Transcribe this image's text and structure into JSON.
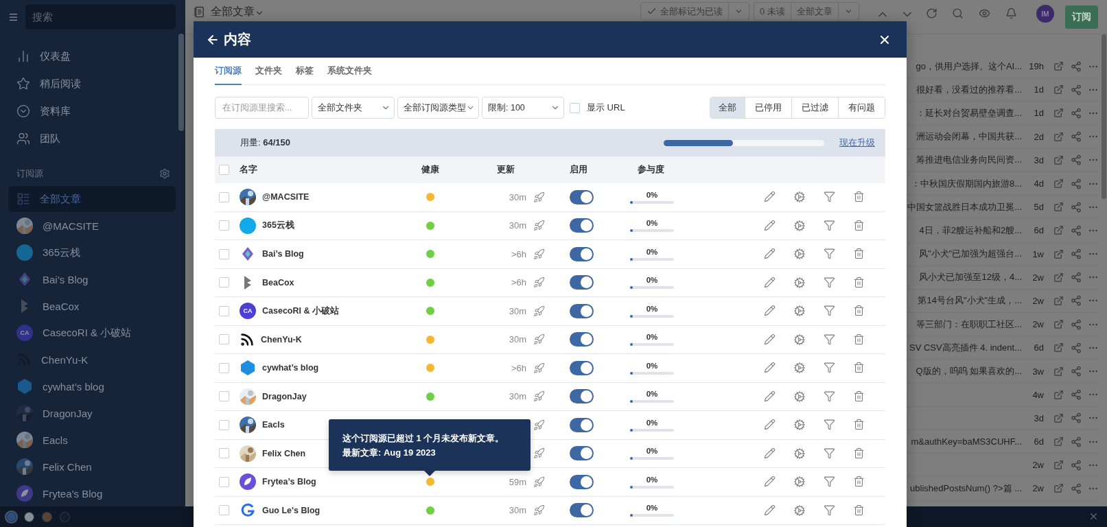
{
  "sidebar": {
    "search": {
      "placeholder": "搜索"
    },
    "nav": [
      "仪表盘",
      "稍后阅读",
      "资料库",
      "团队"
    ],
    "section_title": "订阅源",
    "feeds": [
      {
        "label": "全部文章",
        "kind": "list",
        "selected": true
      },
      {
        "label": "@MACSITE",
        "selected": false
      },
      {
        "label": "365云栈",
        "kind": "blob",
        "selected": false
      },
      {
        "label": "Bai’s Blog",
        "kind": "diamond",
        "selected": false
      },
      {
        "label": "BeaCox",
        "kind": "chevron",
        "selected": false
      },
      {
        "label": "CasecoRI & 小破站",
        "kind": "initials",
        "initials": "CA",
        "selected": false
      },
      {
        "label": "ChenYu-K",
        "kind": "rss",
        "selected": false
      },
      {
        "label": "cywhat’s blog",
        "kind": "hexagon",
        "selected": false
      },
      {
        "label": "DragonJay",
        "selected": false
      },
      {
        "label": "Eacls",
        "selected": false
      },
      {
        "label": "Felix Chen",
        "selected": false
      },
      {
        "label": "Frytea’s Blog",
        "kind": "leaf",
        "selected": false
      }
    ],
    "theme_dots": [
      {
        "color": "#2c4d80",
        "selected": true
      },
      {
        "color": "#8a8e95",
        "selected": false
      },
      {
        "color": "#5a4431",
        "selected": false
      },
      {
        "color": "#161b24",
        "selected": false
      }
    ]
  },
  "toolbar": {
    "title": "全部文章",
    "mark_read": "全部标记为已读",
    "unread": "0 未读",
    "filter": "全部文章",
    "avatar": "IM",
    "subscribe": "订阅"
  },
  "articles": [
    {
      "text": "go，供用户选择。这个AI...",
      "age": "19h"
    },
    {
      "text": "很好看，没看过的推荐看...",
      "age": "1d"
    },
    {
      "text": "：延长对台贸易壁垒调查...",
      "age": "1d"
    },
    {
      "text": "洲运动会闭幕，中国共获...",
      "age": "2d"
    },
    {
      "text": "筹推进电信业务向民间资...",
      "age": "3d"
    },
    {
      "text": "：中秋国庆假期国内旅游8...",
      "age": "4d"
    },
    {
      "text": "中国女篮战胜日本成功卫冕...",
      "age": "5d"
    },
    {
      "text": "4日，菲2艘运补船和2艘...",
      "age": "6d"
    },
    {
      "text": "风\"小犬\"已加强为超强台...",
      "age": "1w"
    },
    {
      "text": "风小犬已加强至12级，4...",
      "age": "2w"
    },
    {
      "text": "第14号台风\"小犬\"生成，...",
      "age": "2w"
    },
    {
      "text": "等三部门：在职职工社区...",
      "age": "2w"
    },
    {
      "text": "SV CSV高亮插件 4. indent...",
      "age": "6d"
    },
    {
      "text": "Q版的，呜呜 如果喜欢的...",
      "age": "3w"
    },
    {
      "age": "4w"
    },
    {
      "age": "3d"
    },
    {
      "text": "m&authKey=baMS3CUHF...",
      "age": "6d"
    },
    {
      "age": "2w"
    },
    {
      "text": "ublishedPostsNum() ?>篇 ...",
      "age": "2w"
    }
  ],
  "modal": {
    "title": "内容",
    "tabs": [
      {
        "label": "订阅源",
        "selected": true
      },
      {
        "label": "文件夹",
        "selected": false
      },
      {
        "label": "标签",
        "selected": false
      },
      {
        "label": "系统文件夹",
        "selected": false
      }
    ],
    "search": {
      "placeholder": "在订阅源里搜索..."
    },
    "selects": [
      "全部文件夹",
      "全部订阅源类型",
      "限制: 100"
    ],
    "show_url": {
      "label": "显示 URL",
      "checked": false
    },
    "segments": [
      {
        "label": "全部",
        "selected": true
      },
      {
        "label": "已停用",
        "selected": false
      },
      {
        "label": "已过滤",
        "selected": false
      },
      {
        "label": "有问题",
        "selected": false
      }
    ],
    "usage": {
      "label": "用量: **64/150**",
      "level": 0.43,
      "upgrade": "现在升级"
    },
    "select_all": {
      "checked": false
    },
    "columns": [
      "名字",
      "健康",
      "更新",
      "启用",
      "参与度"
    ],
    "rows": [
      {
        "name": "@MACSITE",
        "checked": false,
        "color": "#f5b731",
        "update": "30m",
        "enabled": true,
        "engagement": "0%",
        "level": 0
      },
      {
        "name": "365云栈",
        "kind": "blob",
        "checked": false,
        "color": "#6fcf45",
        "update": "30m",
        "enabled": true,
        "engagement": "0%",
        "level": 0
      },
      {
        "name": "Bai’s Blog",
        "kind": "diamond",
        "checked": false,
        "color": "#6fcf45",
        "update": ">6h",
        "enabled": true,
        "engagement": "0%",
        "level": 0
      },
      {
        "name": "BeaCox",
        "kind": "chevron",
        "checked": false,
        "color": "#6fcf45",
        "update": ">6h",
        "enabled": true,
        "engagement": "0%",
        "level": 0
      },
      {
        "name": "CasecoRI & 小破站",
        "kind": "initials",
        "initials": "CA",
        "checked": false,
        "color": "#6fcf45",
        "update": "30m",
        "enabled": true,
        "engagement": "0%",
        "level": 0
      },
      {
        "name": "ChenYu-K",
        "kind": "rss",
        "checked": false,
        "color": "#f5b731",
        "update": "30m",
        "enabled": true,
        "engagement": "0%",
        "level": 0
      },
      {
        "name": "cywhat’s blog",
        "kind": "hexagon",
        "checked": false,
        "color": "#f5b731",
        "update": ">6h",
        "enabled": true,
        "engagement": "0%",
        "level": 0
      },
      {
        "name": "DragonJay",
        "checked": false,
        "color": "#6fcf45",
        "update": "30m",
        "enabled": true,
        "engagement": "0%",
        "level": 0
      },
      {
        "name": "Eacls",
        "checked": false,
        "enabled": true,
        "engagement": "0%",
        "level": 0
      },
      {
        "name": "Felix Chen",
        "checked": false,
        "enabled": true,
        "engagement": "0%",
        "level": 0
      },
      {
        "name": "Frytea’s Blog",
        "kind": "leaf",
        "checked": false,
        "color": "#f5b731",
        "update": "59m",
        "enabled": true,
        "engagement": "0%",
        "level": 0
      },
      {
        "name": "Guo Le's Blog",
        "kind": "gmark",
        "checked": false,
        "color": "#6fcf45",
        "update": "30m",
        "enabled": true,
        "engagement": "0%",
        "level": 0
      }
    ],
    "tooltip": {
      "lines": [
        "这个订阅源已超过 1 个月未发布新文章。",
        "最新文章: Aug 19 2023"
      ]
    }
  }
}
